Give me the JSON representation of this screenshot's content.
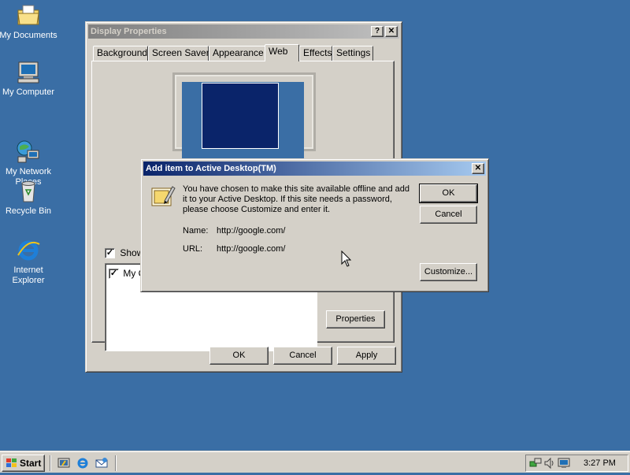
{
  "desktop": {
    "icons": [
      {
        "label": "My Documents",
        "icon": "folder-documents-icon"
      },
      {
        "label": "My Computer",
        "icon": "computer-icon"
      },
      {
        "label": "My Network\nPlaces",
        "icon": "network-icon"
      },
      {
        "label": "Recycle Bin",
        "icon": "recycle-bin-icon"
      },
      {
        "label": "Internet\nExplorer",
        "icon": "internet-explorer-icon"
      }
    ]
  },
  "display_properties": {
    "title": "Display Properties",
    "help_btn": "?",
    "close_btn": "✕",
    "tabs": [
      "Background",
      "Screen Saver",
      "Appearance",
      "Web",
      "Effects",
      "Settings"
    ],
    "selected_tab": "Web",
    "show_checkbox_label": "Show",
    "show_checked": true,
    "list_item": "My C",
    "list_item_checked": true,
    "properties_btn": "Properties",
    "ok_btn": "OK",
    "cancel_btn": "Cancel",
    "apply_btn": "Apply"
  },
  "dialog": {
    "title": "Add item to Active Desktop(TM)",
    "close_btn": "✕",
    "message": "You have chosen to make this site available offline and add it to your Active Desktop. If this site needs a password, please choose Customize and enter it.",
    "name_label": "Name:",
    "name_value": "http://google.com/",
    "url_label": "URL:",
    "url_value": "http://google.com/",
    "ok_btn": "OK",
    "cancel_btn": "Cancel",
    "customize_btn": "Customize..."
  },
  "taskbar": {
    "start_label": "Start",
    "quick_launch": [
      "show-desktop-icon",
      "internet-explorer-icon",
      "outlook-express-icon"
    ],
    "tray_icons": [
      "network-tray-icon",
      "volume-icon",
      "display-tray-icon"
    ],
    "clock": "3:27 PM"
  },
  "colors": {
    "desktop": "#3a6ea5",
    "active_title": "#0a246a",
    "inactive_title": "#808080",
    "face": "#d4d0c8"
  }
}
